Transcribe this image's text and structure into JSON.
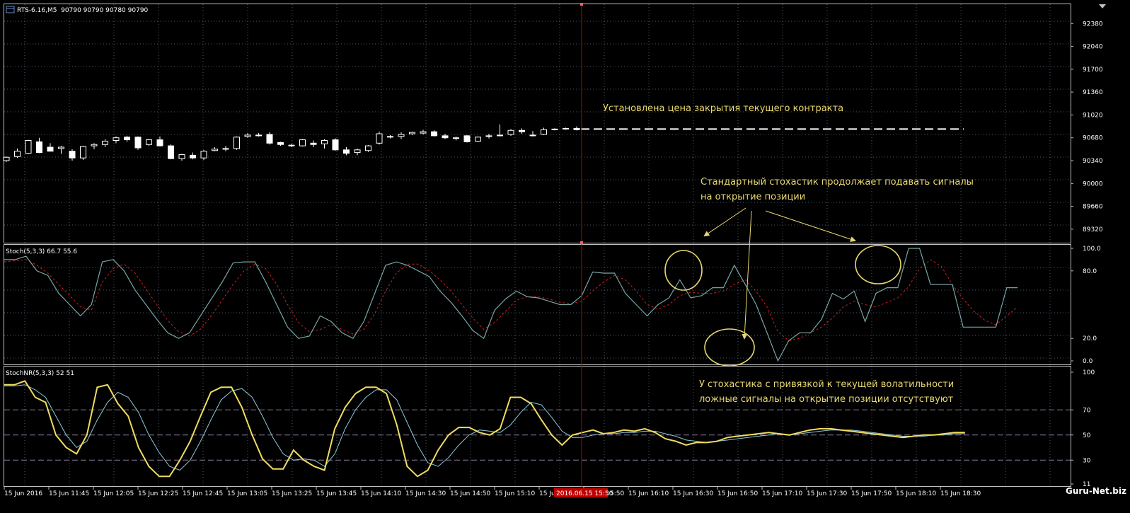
{
  "window": {
    "symbol_info": "RTS-6.16,M5  90790 90790 90780 90790"
  },
  "watermark": "Guru-Net.biz",
  "colors": {
    "background": "#000000",
    "grid": "#4a5a6a",
    "frame": "#c0c0c0",
    "axis_text": "#ffffff",
    "candle": "#ffffff",
    "annotation": "#e8d870",
    "vline": "#c00000",
    "stoch_main": "#7aa6a6",
    "stoch_signal": "#cc2020",
    "stochnr_main": "#f0dc60",
    "stochnr_signal": "#8cc8d8"
  },
  "annotations": {
    "close_price": "Установлена цена закрытия текущего контракта",
    "standard_line1": "Стандартный стохастик продолжает подавать сигналы",
    "standard_line2": "на открытие позиции",
    "nr_line1": "У стохастика с привязкой к текущей волатильности",
    "nr_line2": "ложные сигналы на открытие позиции отсутствуют"
  },
  "time_axis": {
    "labels": [
      "15 Jun 2016",
      "15 Jun 11:45",
      "15 Jun 12:05",
      "15 Jun 12:25",
      "15 Jun 12:45",
      "15 Jun 13:05",
      "15 Jun 13:25",
      "15 Jun 13:45",
      "15 Jun 14:10",
      "15 Jun 14:30",
      "15 Jun 14:50",
      "15 Jun 15:10",
      "15 Jun 15:30",
      "15 Jun 15:50",
      "15 Jun 16:10",
      "15 Jun 16:30",
      "15 Jun 16:50",
      "15 Jun 17:10",
      "15 Jun 17:30",
      "15 Jun 17:50",
      "15 Jun 18:10",
      "15 Jun 18:30"
    ],
    "highlight_label": "2016.06.15 15:50"
  },
  "chart_data": [
    {
      "type": "candlestick",
      "name": "RTS-6.16,M5",
      "y_ticks": [
        92380,
        92040,
        91700,
        91360,
        91020,
        90680,
        90340,
        90000,
        89660,
        89320
      ],
      "ylim": [
        89150,
        92520
      ],
      "close_price_level": 90810,
      "candles": [
        [
          90340,
          90400,
          90320,
          90390
        ],
        [
          90400,
          90520,
          90380,
          90480
        ],
        [
          90450,
          90650,
          90440,
          90640
        ],
        [
          90620,
          90680,
          90450,
          90460
        ],
        [
          90540,
          90600,
          90480,
          90480
        ],
        [
          90520,
          90560,
          90440,
          90540
        ],
        [
          90480,
          90510,
          90340,
          90380
        ],
        [
          90380,
          90560,
          90350,
          90550
        ],
        [
          90560,
          90600,
          90510,
          90580
        ],
        [
          90580,
          90660,
          90540,
          90630
        ],
        [
          90640,
          90700,
          90600,
          90680
        ],
        [
          90690,
          90710,
          90620,
          90650
        ],
        [
          90690,
          90700,
          90500,
          90530
        ],
        [
          90580,
          90660,
          90560,
          90650
        ],
        [
          90650,
          90700,
          90550,
          90560
        ],
        [
          90560,
          90580,
          90360,
          90370
        ],
        [
          90370,
          90440,
          90340,
          90430
        ],
        [
          90420,
          90460,
          90360,
          90380
        ],
        [
          90380,
          90500,
          90350,
          90480
        ],
        [
          90490,
          90540,
          90480,
          90510
        ],
        [
          90510,
          90560,
          90480,
          90520
        ],
        [
          90520,
          90700,
          90500,
          90690
        ],
        [
          90700,
          90750,
          90680,
          90720
        ],
        [
          90720,
          90750,
          90700,
          90710
        ],
        [
          90730,
          90760,
          90580,
          90600
        ],
        [
          90610,
          90620,
          90560,
          90580
        ],
        [
          90570,
          90590,
          90540,
          90560
        ],
        [
          90560,
          90660,
          90550,
          90650
        ],
        [
          90600,
          90640,
          90540,
          90580
        ],
        [
          90590,
          90660,
          90520,
          90640
        ],
        [
          90650,
          90670,
          90490,
          90500
        ],
        [
          90500,
          90540,
          90420,
          90450
        ],
        [
          90460,
          90520,
          90420,
          90500
        ],
        [
          90490,
          90570,
          90470,
          90560
        ],
        [
          90600,
          90770,
          90580,
          90740
        ],
        [
          90690,
          90720,
          90670,
          90700
        ],
        [
          90700,
          90760,
          90660,
          90730
        ],
        [
          90740,
          90770,
          90720,
          90760
        ],
        [
          90750,
          90800,
          90730,
          90770
        ],
        [
          90770,
          90790,
          90700,
          90710
        ],
        [
          90710,
          90740,
          90660,
          90680
        ],
        [
          90670,
          90700,
          90640,
          90680
        ],
        [
          90710,
          90720,
          90610,
          90620
        ],
        [
          90630,
          90700,
          90620,
          90690
        ],
        [
          90700,
          90740,
          90670,
          90710
        ],
        [
          90710,
          90880,
          90700,
          90720
        ],
        [
          90730,
          90810,
          90710,
          90790
        ],
        [
          90790,
          90820,
          90740,
          90770
        ],
        [
          90720,
          90780,
          90700,
          90710
        ],
        [
          90730,
          90830,
          90720,
          90800
        ],
        [
          90800,
          90820,
          90790,
          90810
        ],
        [
          90810,
          90830,
          90800,
          90820
        ],
        [
          90820,
          90850,
          90790,
          90800
        ]
      ]
    },
    {
      "type": "line",
      "name": "Stoch(5,3,3) 66.7 55.6",
      "y_ticks": [
        100.0,
        80.0,
        20.0,
        0.0
      ],
      "ylim": [
        0,
        100
      ],
      "series": [
        {
          "values": [
            90,
            90,
            93,
            80,
            76,
            60,
            50,
            40,
            50,
            88,
            90,
            80,
            63,
            50,
            37,
            25,
            20,
            25,
            40,
            55,
            70,
            87,
            88,
            88,
            70,
            50,
            30,
            20,
            22,
            40,
            35,
            25,
            20,
            35,
            60,
            85,
            88,
            85,
            80,
            75,
            62,
            52,
            40,
            27,
            20,
            45,
            55,
            62,
            57,
            56,
            53,
            50,
            50,
            58,
            79,
            78,
            78,
            60,
            50,
            40,
            50,
            56,
            72,
            56,
            58,
            65,
            65,
            85,
            68,
            50,
            25,
            0,
            18,
            25,
            25,
            37,
            60,
            55,
            62,
            35,
            60,
            65,
            65,
            100,
            100,
            68,
            68,
            68,
            30,
            30,
            30,
            30,
            65,
            65
          ]
        },
        {
          "values": [
            88,
            89,
            90,
            85,
            78,
            68,
            58,
            48,
            45,
            70,
            82,
            86,
            78,
            64,
            50,
            36,
            26,
            22,
            28,
            40,
            54,
            68,
            80,
            86,
            82,
            68,
            50,
            34,
            26,
            28,
            32,
            28,
            24,
            28,
            42,
            62,
            78,
            86,
            86,
            80,
            72,
            62,
            50,
            38,
            28,
            34,
            44,
            54,
            57,
            57,
            55,
            52,
            51,
            53,
            62,
            70,
            76,
            72,
            62,
            50,
            46,
            50,
            58,
            61,
            60,
            60,
            62,
            68,
            72,
            62,
            48,
            26,
            18,
            20,
            25,
            30,
            38,
            48,
            53,
            50,
            48,
            52,
            56,
            66,
            82,
            90,
            84,
            68,
            55,
            44,
            36,
            32,
            40,
            48
          ]
        }
      ]
    },
    {
      "type": "line",
      "name": "StochNR(5,3,3) 52 51",
      "y_ticks": [
        100,
        70,
        50,
        30,
        11
      ],
      "ylim": [
        11,
        100
      ],
      "series": [
        {
          "values": [
            90,
            90,
            93,
            80,
            76,
            50,
            40,
            35,
            50,
            88,
            90,
            75,
            65,
            40,
            25,
            17,
            17,
            30,
            45,
            65,
            84,
            88,
            88,
            72,
            50,
            31,
            23,
            23,
            38,
            30,
            25,
            22,
            55,
            72,
            83,
            88,
            88,
            83,
            58,
            25,
            17,
            22,
            38,
            50,
            56,
            56,
            52,
            50,
            55,
            80,
            80,
            75,
            62,
            50,
            42,
            50,
            52,
            54,
            51,
            52,
            54,
            53,
            55,
            52,
            47,
            45,
            42,
            44,
            44,
            45,
            48,
            49,
            50,
            51,
            52,
            51,
            50,
            52,
            54,
            55,
            55,
            54,
            53,
            52,
            51,
            50,
            49,
            48,
            49,
            50,
            50,
            51,
            52,
            52
          ]
        },
        {
          "values": [
            89,
            89,
            90,
            86,
            80,
            65,
            50,
            40,
            45,
            62,
            76,
            84,
            80,
            68,
            50,
            36,
            25,
            22,
            30,
            45,
            62,
            78,
            85,
            87,
            80,
            65,
            48,
            35,
            30,
            31,
            30,
            25,
            35,
            55,
            70,
            80,
            86,
            86,
            78,
            60,
            42,
            28,
            25,
            32,
            42,
            50,
            54,
            53,
            52,
            58,
            68,
            76,
            74,
            64,
            53,
            48,
            48,
            50,
            51,
            51,
            52,
            52,
            53,
            53,
            51,
            49,
            46,
            45,
            44,
            45,
            46,
            47,
            48,
            49,
            50,
            51,
            50,
            51,
            52,
            53,
            54,
            54,
            54,
            53,
            52,
            51,
            50,
            49,
            49,
            49,
            50,
            50,
            51,
            51
          ]
        }
      ]
    }
  ]
}
